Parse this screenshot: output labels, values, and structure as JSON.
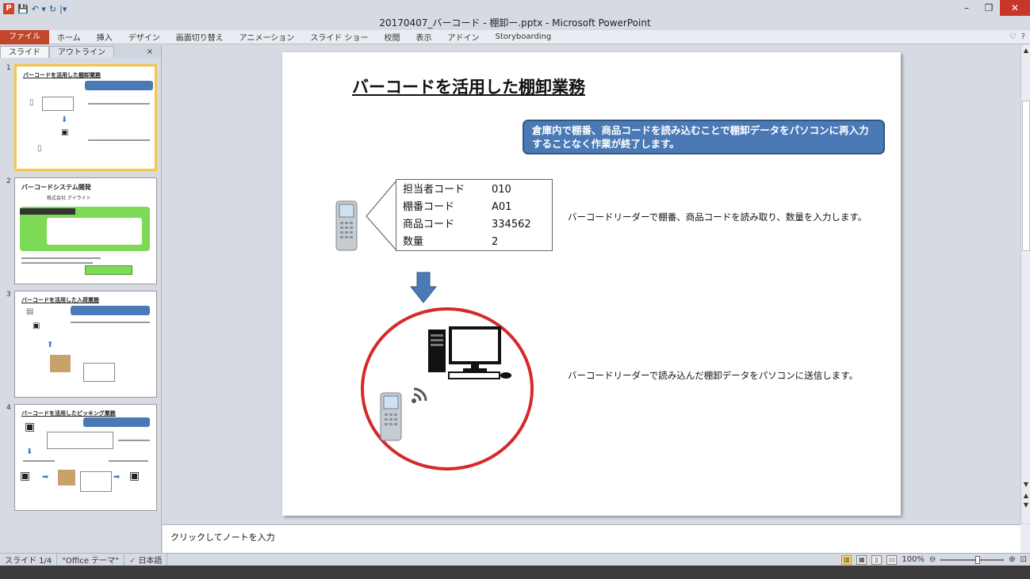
{
  "window": {
    "title": "20170407_バーコード - 棚卸ー.pptx - Microsoft PowerPoint",
    "app_badge": "P",
    "qat": [
      "💾",
      "↶ ▾",
      "↻",
      "|▾"
    ],
    "controls": {
      "minimize": "–",
      "restore": "❐",
      "close": "✕"
    }
  },
  "ribbon": {
    "file": "ファイル",
    "tabs": [
      "ホーム",
      "挿入",
      "デザイン",
      "画面切り替え",
      "アニメーション",
      "スライド ショー",
      "校閲",
      "表示",
      "アドイン",
      "Storyboarding"
    ],
    "right_icons": [
      "♡",
      "?"
    ]
  },
  "panel": {
    "tabs": [
      "スライド",
      "アウトライン"
    ],
    "close": "×",
    "slides": [
      {
        "num": "1",
        "title": "バーコードを活用した棚卸業務"
      },
      {
        "num": "2",
        "title": "バーコードシステム開発",
        "sub": "株式会社 アイライト"
      },
      {
        "num": "3",
        "title": "バーコードを活用した入荷業務"
      },
      {
        "num": "4",
        "title": "バーコードを活用したピッキング業務"
      }
    ]
  },
  "slide": {
    "title": "バーコードを活用した棚卸業務",
    "callout": "倉庫内で棚番、商品コードを読み込むことで棚卸データをパソコンに再入力することなく作業が終了します。",
    "table": [
      {
        "key": "担当者コード",
        "value": "010"
      },
      {
        "key": "棚番コード",
        "value": "A01"
      },
      {
        "key": "商品コード",
        "value": "334562"
      },
      {
        "key": "数量",
        "value": "2"
      }
    ],
    "desc1": "バーコードリーダーで棚番、商品コードを読み取り、数量を入力します。",
    "desc2": "バーコードリーダーで読み込んだ棚卸データをパソコンに送信します。"
  },
  "notes": {
    "placeholder": "クリックしてノートを入力"
  },
  "status": {
    "slide": "スライド 1/4",
    "theme": "\"Office テーマ\"",
    "lang": "日本語",
    "zoom": "100%"
  },
  "colors": {
    "accent": "#4a79b5",
    "circle": "#d42a2a",
    "file_tab": "#c2462a"
  }
}
